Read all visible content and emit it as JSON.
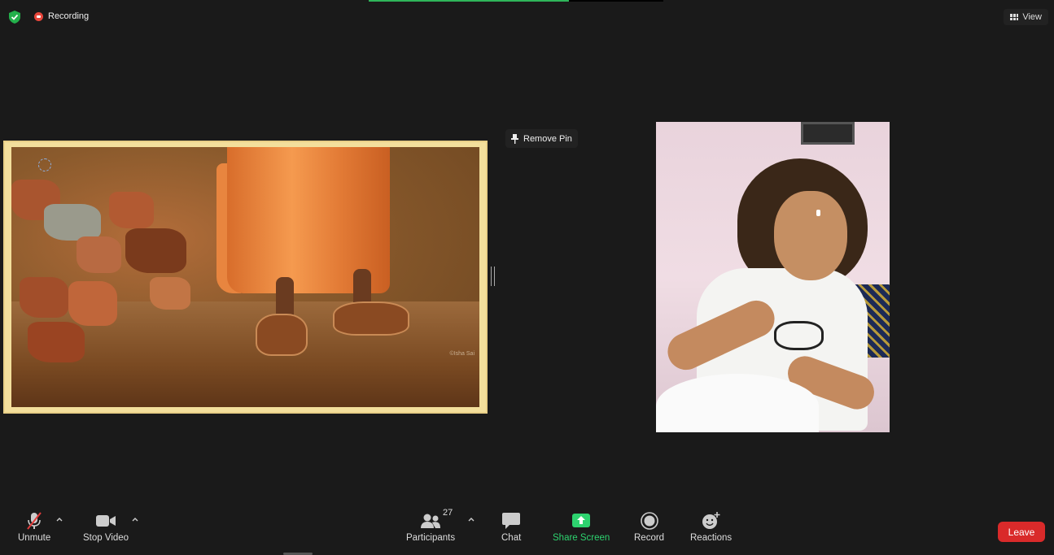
{
  "meeting": {
    "recording_label": "Recording",
    "view_label": "View",
    "remove_pin_label": "Remove Pin",
    "progress": 0.68
  },
  "shared_content": {
    "watermark": "©Isha Sai"
  },
  "toolbar": {
    "unmute_label": "Unmute",
    "stop_video_label": "Stop Video",
    "participants_label": "Participants",
    "participants_count": "27",
    "chat_label": "Chat",
    "share_screen_label": "Share Screen",
    "record_label": "Record",
    "reactions_label": "Reactions",
    "leave_label": "Leave"
  },
  "colors": {
    "background": "#1a1a1a",
    "accent_green": "#2dd36f",
    "leave_red": "#d92a2a",
    "recording_red": "#e8463b"
  },
  "icons": {
    "security": "shield-check-icon",
    "recording": "record-dot-icon",
    "view": "grid-icon",
    "pin": "pin-icon",
    "mic": "microphone-muted-icon",
    "video": "video-camera-icon",
    "participants": "people-icon",
    "chat": "chat-bubble-icon",
    "share": "share-screen-icon",
    "record": "record-icon",
    "reactions": "smiley-plus-icon"
  }
}
